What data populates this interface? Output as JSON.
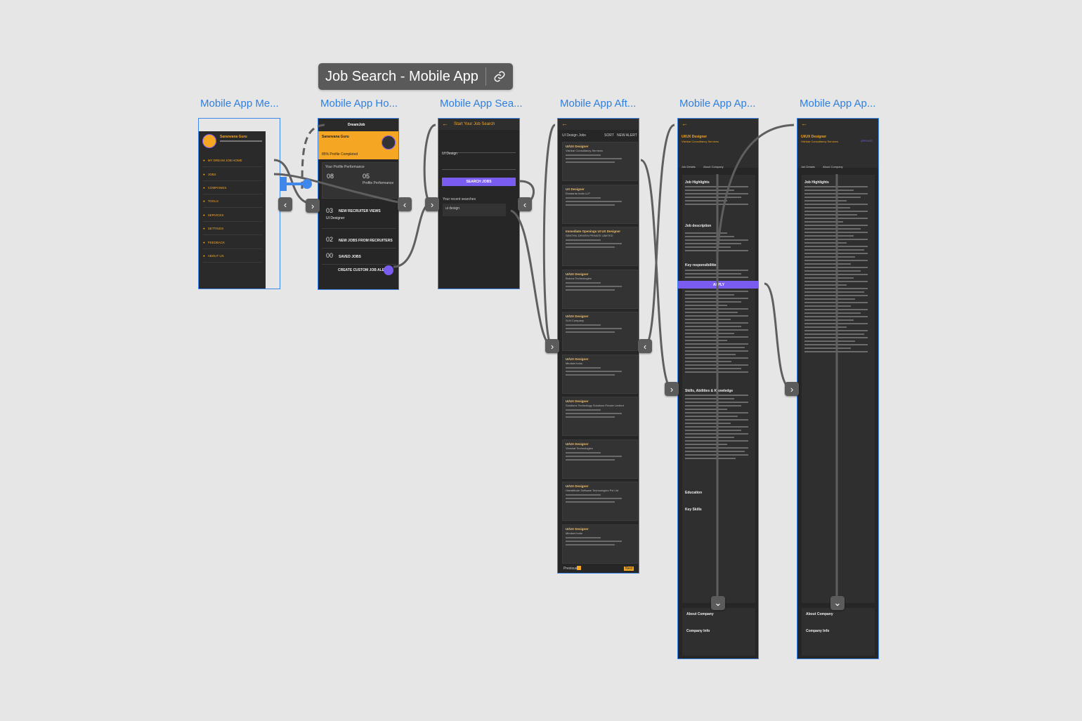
{
  "flow": {
    "title": "Job Search - Mobile App"
  },
  "frames": [
    {
      "label": "Mobile App Me..."
    },
    {
      "label": "Mobile App Ho..."
    },
    {
      "label": "Mobile App Sea..."
    },
    {
      "label": "Mobile App Aft..."
    },
    {
      "label": "Mobile App Ap..."
    },
    {
      "label": "Mobile App Ap..."
    }
  ],
  "menu_screen": {
    "user_name": "Saranvana Guru",
    "menu_items": [
      "MY DREAM JOB HOME",
      "JOBS",
      "COMPANIES",
      "TOOLS",
      "SERVICES",
      "SETTINGS",
      "FEEDBACK",
      "ABOUT US"
    ]
  },
  "home_screen": {
    "brand": "DreamJob",
    "user_name": "Saranvana Guru",
    "profile_completed": "85% Profile Completed",
    "performance_title": "Your Profile Performance",
    "stat1_value": "08",
    "stat2_value": "05",
    "stat2_label": "Profile Performance",
    "recruiter_count": "03",
    "recruiter_label": "NEW RECRUITER VIEWS",
    "recruiter_job": "UI Designer",
    "jobs_from_recruiters_count": "02",
    "jobs_from_recruiters_label": "NEW JOBS FROM RECRUITERS",
    "saved_jobs_count": "00",
    "saved_jobs_label": "SAVED JOBS",
    "create_alert_label": "CREATE CUSTOM JOB ALERTS"
  },
  "search_screen": {
    "header": "Start Your Job Search",
    "keyword_value": "UI Design",
    "search_button": "SEARCH JOBS",
    "recent_label": "Your recent searches",
    "recent_item": "ui design"
  },
  "results_screen": {
    "header": "UI Design Jobs",
    "sort_label": "SORT",
    "filter_label": "NEW ALERT",
    "jobs": [
      {
        "title": "UI/UX Designer",
        "company": "Vishkar Consultancy Services"
      },
      {
        "title": "UX Designer",
        "company": "Ekadanta India LLP"
      },
      {
        "title": "Immediate Openings UI UX Designer",
        "company": "SENTHIL DRIVEN PRIVATE LIMITED"
      },
      {
        "title": "UI/UX Designer",
        "company": "Bravus Technologies"
      },
      {
        "title": "UI/UX Designer",
        "company": "SLN Company"
      },
      {
        "title": "UI/UX Designer",
        "company": "Mindset India"
      },
      {
        "title": "UI/UX Designer",
        "company": "Solutions Technology Solutions Private Limited"
      },
      {
        "title": "UI/UX Designer",
        "company": "Vimshat Technologies"
      },
      {
        "title": "UI/UX Designer",
        "company": "Hirealtitude Software Technologies Pvt Ltd"
      },
      {
        "title": "UI/UX Designer",
        "company": "Mindset India"
      }
    ],
    "pagination_prev": "Previous",
    "pagination_next": "Next"
  },
  "apply_screen_1": {
    "job_title": "UI/UX Designer",
    "company": "Vishkar Consultancy Services",
    "tab1": "Job Details",
    "tab2": "About Company",
    "apply_button": "APPLY",
    "section_highlights": "Job Highlights",
    "section_description": "Job description",
    "section_responsibilities": "Key responsibilities",
    "section_skills": "Skills, Abilities & Knowledge",
    "education_label": "Education",
    "key_skills_label": "Key Skills",
    "about_company": "About Company",
    "company_info": "Company Info"
  },
  "apply_screen_2": {
    "job_title": "UI/UX Designer",
    "company": "Vishkar Consultancy Services",
    "applied_badge": "APPLIED",
    "tab1": "Job Details",
    "tab2": "About Company",
    "section_highlights": "Job Highlights",
    "about_company": "About Company",
    "company_info": "Company Info"
  },
  "colors": {
    "accent": "#f5a623",
    "purple": "#7b5cf0",
    "selection": "#3f87ea",
    "link": "#2f7fe0"
  }
}
